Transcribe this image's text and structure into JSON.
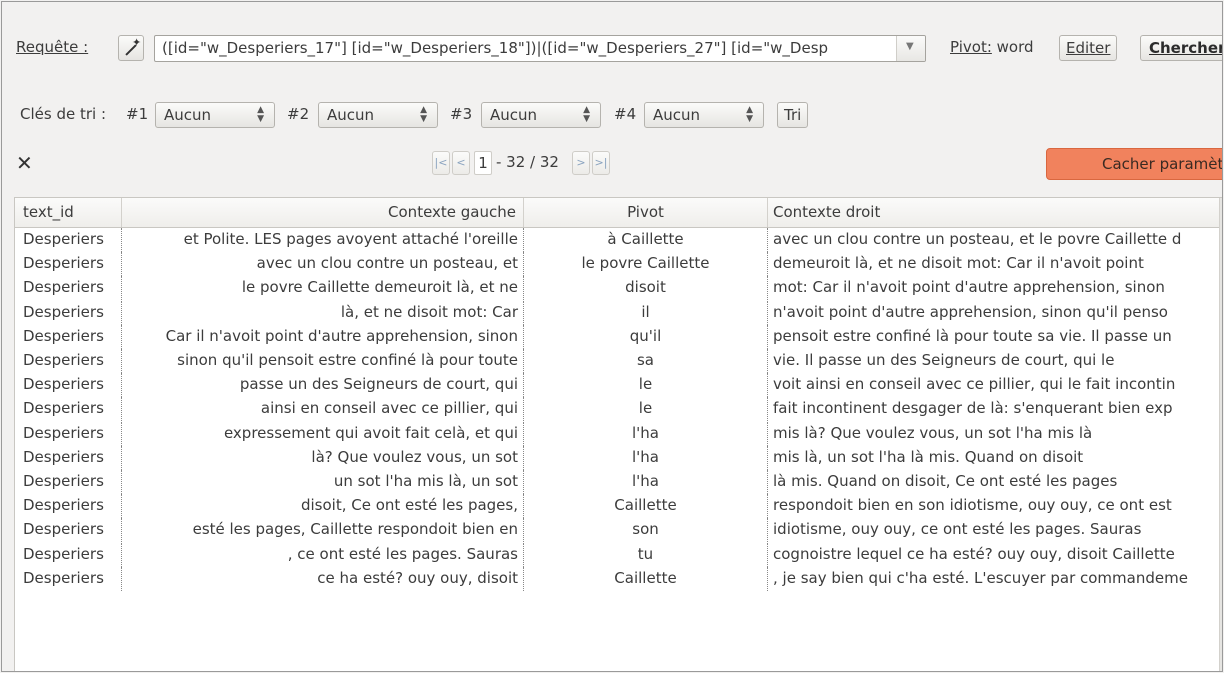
{
  "toolbar": {
    "query_label": "Requête :",
    "query_value": "([id=\"w_Desperiers_17\"] [id=\"w_Desperiers_18\"])|([id=\"w_Desperiers_27\"] [id=\"w_Desp",
    "pivot_label": "Pivot:",
    "pivot_value": "word",
    "edit_label": "Editer",
    "search_label": "Chercher"
  },
  "sort": {
    "label": "Clés de tri :",
    "keys": [
      {
        "label": "#1",
        "value": "Aucun"
      },
      {
        "label": "#2",
        "value": "Aucun"
      },
      {
        "label": "#3",
        "value": "Aucun"
      },
      {
        "label": "#4",
        "value": "Aucun"
      }
    ],
    "sort_button": "Tri"
  },
  "nav": {
    "first": "|<",
    "prev": "<",
    "page": "1",
    "range": "- 32 / 32",
    "next": ">",
    "last": ">|",
    "hide_params": "Cacher paramètres"
  },
  "table": {
    "columns": [
      "text_id",
      "Contexte gauche",
      "Pivot",
      "Contexte droit"
    ],
    "rows": [
      [
        "Desperiers",
        "et Polite. LES pages avoyent attaché l'oreille",
        "à Caillette",
        "avec un clou contre un posteau, et le povre Caillette d"
      ],
      [
        "Desperiers",
        "avec un clou contre un posteau, et",
        "le povre Caillette",
        "demeuroit là, et ne disoit mot: Car il n'avoit point"
      ],
      [
        "Desperiers",
        "le povre Caillette demeuroit là, et ne",
        "disoit",
        "mot: Car il n'avoit point d'autre apprehension, sinon"
      ],
      [
        "Desperiers",
        "là, et ne disoit mot: Car",
        "il",
        "n'avoit point d'autre apprehension, sinon qu'il penso"
      ],
      [
        "Desperiers",
        "Car il n'avoit point d'autre apprehension, sinon",
        "qu'il",
        "pensoit estre confiné là pour toute sa vie. Il passe un"
      ],
      [
        "Desperiers",
        "sinon qu'il pensoit estre confiné là pour toute",
        "sa",
        "vie. Il passe un des Seigneurs de court, qui le"
      ],
      [
        "Desperiers",
        "passe un des Seigneurs de court, qui",
        "le",
        "voit ainsi en conseil avec ce pillier, qui le fait incontin"
      ],
      [
        "Desperiers",
        "ainsi en conseil avec ce pillier, qui",
        "le",
        "fait incontinent desgager de là: s'enquerant bien exp"
      ],
      [
        "Desperiers",
        "expressement qui avoit fait celà, et qui",
        "l'ha",
        "mis là? Que voulez vous, un sot l'ha mis là"
      ],
      [
        "Desperiers",
        "là? Que voulez vous, un sot",
        "l'ha",
        "mis là, un sot l'ha là mis. Quand on disoit"
      ],
      [
        "Desperiers",
        "un sot l'ha mis là, un sot",
        "l'ha",
        "là mis. Quand on disoit, Ce ont esté les pages"
      ],
      [
        "Desperiers",
        "disoit, Ce ont esté les pages,",
        "Caillette",
        "respondoit bien en son idiotisme, ouy ouy, ce ont est"
      ],
      [
        "Desperiers",
        "esté les pages, Caillette respondoit bien en",
        "son",
        "idiotisme, ouy ouy, ce ont esté les pages. Sauras"
      ],
      [
        "Desperiers",
        ", ce ont esté les pages. Sauras",
        "tu",
        "cognoistre lequel ce ha esté? ouy ouy, disoit Caillette"
      ],
      [
        "Desperiers",
        "ce ha esté? ouy ouy, disoit",
        "Caillette",
        ", je say bien qui c'ha esté. L'escuyer par commandeme"
      ]
    ]
  }
}
